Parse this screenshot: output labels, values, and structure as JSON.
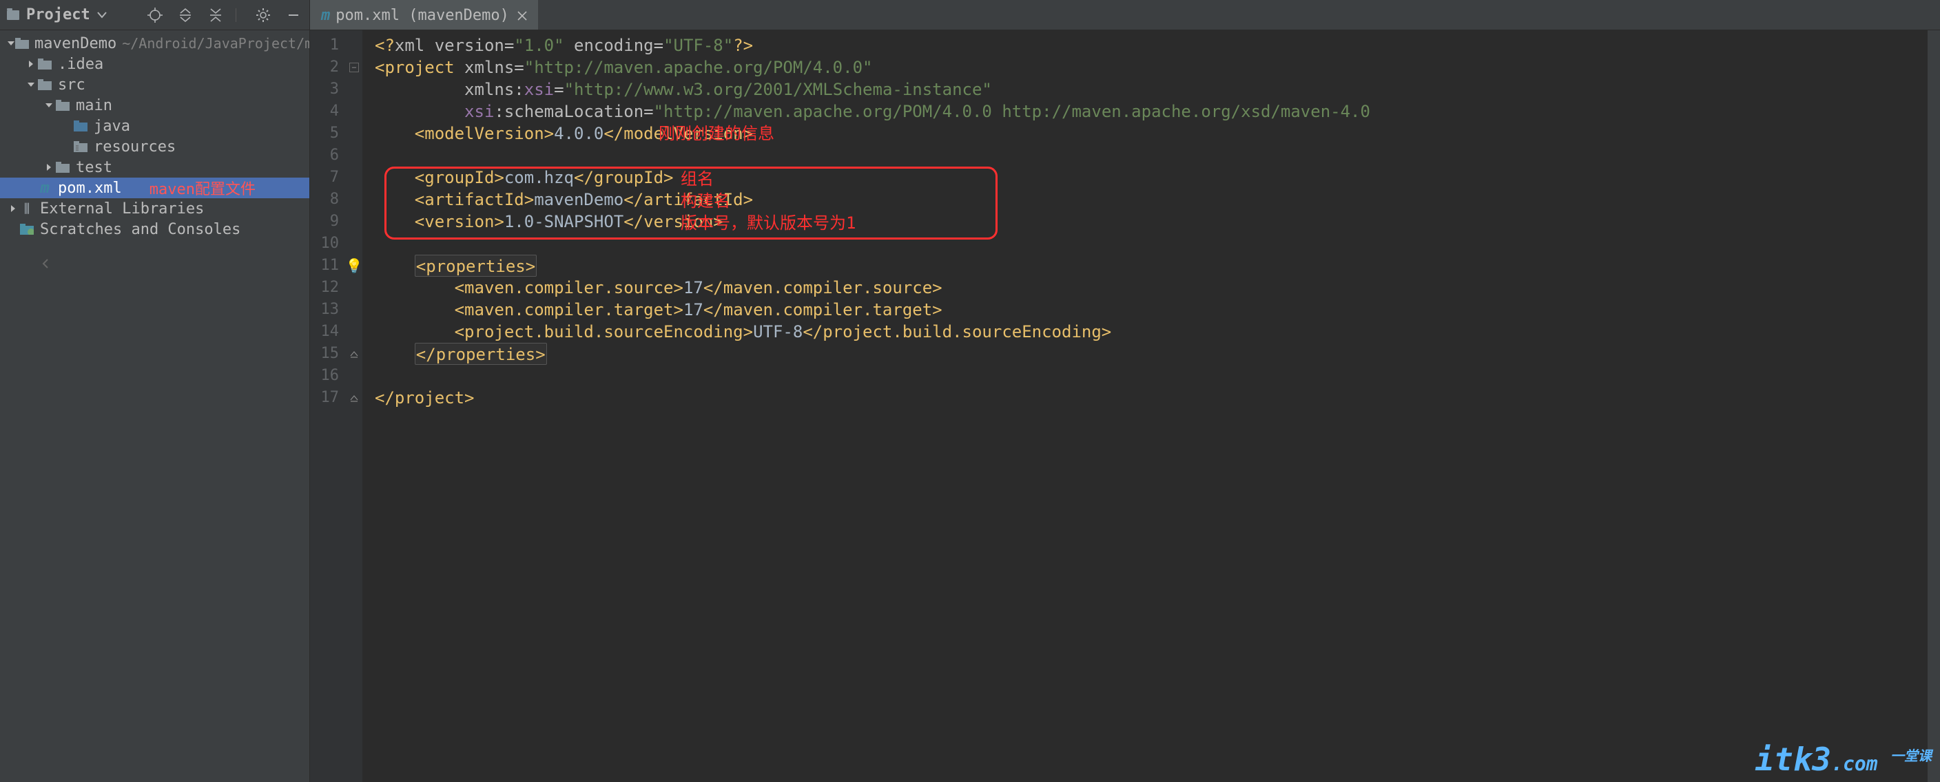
{
  "sidebar": {
    "title": "Project",
    "items": [
      {
        "label": "mavenDemo",
        "sub": "~/Android/JavaProject/mavenDem",
        "depth": 0,
        "expanded": true,
        "icon": "folder-project",
        "arrow": "down"
      },
      {
        "label": ".idea",
        "depth": 1,
        "icon": "folder",
        "arrow": "right"
      },
      {
        "label": "src",
        "depth": 1,
        "icon": "folder",
        "arrow": "down"
      },
      {
        "label": "main",
        "depth": 2,
        "icon": "folder",
        "arrow": "down"
      },
      {
        "label": "java",
        "depth": 3,
        "icon": "folder-blue",
        "arrow": ""
      },
      {
        "label": "resources",
        "depth": 3,
        "icon": "folder-res",
        "arrow": ""
      },
      {
        "label": "test",
        "depth": 2,
        "icon": "folder",
        "arrow": "right"
      },
      {
        "label": "pom.xml",
        "depth": 1,
        "icon": "m",
        "arrow": "",
        "selected": true,
        "annot": "maven配置文件"
      },
      {
        "label": "External Libraries",
        "depth": 0,
        "icon": "lib",
        "arrow": "right"
      },
      {
        "label": "Scratches and Consoles",
        "depth": 0,
        "icon": "scratch",
        "arrow": ""
      }
    ]
  },
  "tab": {
    "title": "pom.xml (mavenDemo)"
  },
  "annotations": {
    "header": "刚刚创建的信息",
    "group": "组名",
    "artifact": "构建名",
    "version": "版本号，默认版本号为1"
  },
  "code": {
    "lines": [
      {
        "n": 1,
        "fold": "",
        "segs": [
          {
            "t": "<?",
            "c": "c-tag"
          },
          {
            "t": "xml version",
            "c": "c-attr"
          },
          {
            "t": "=",
            "c": "c-attr"
          },
          {
            "t": "\"1.0\"",
            "c": "c-str"
          },
          {
            "t": " encoding",
            "c": "c-attr"
          },
          {
            "t": "=",
            "c": "c-attr"
          },
          {
            "t": "\"UTF-8\"",
            "c": "c-str"
          },
          {
            "t": "?>",
            "c": "c-tag"
          }
        ]
      },
      {
        "n": 2,
        "fold": "minus",
        "segs": [
          {
            "t": "<project ",
            "c": "c-tag"
          },
          {
            "t": "xmlns",
            "c": "c-attr"
          },
          {
            "t": "=",
            "c": "c-attr"
          },
          {
            "t": "\"http://maven.apache.org/POM/4.0.0\"",
            "c": "c-str"
          }
        ]
      },
      {
        "n": 3,
        "segs": [
          {
            "t": "         ",
            "c": "c-text"
          },
          {
            "t": "xmlns:",
            "c": "c-attr"
          },
          {
            "t": "xsi",
            "c": "c-ns"
          },
          {
            "t": "=",
            "c": "c-attr"
          },
          {
            "t": "\"http://www.w3.org/2001/XMLSchema-instance\"",
            "c": "c-str"
          }
        ]
      },
      {
        "n": 4,
        "segs": [
          {
            "t": "         ",
            "c": "c-text"
          },
          {
            "t": "xsi",
            "c": "c-ns"
          },
          {
            "t": ":schemaLocation",
            "c": "c-attr"
          },
          {
            "t": "=",
            "c": "c-attr"
          },
          {
            "t": "\"http://maven.apache.org/POM/4.0.0 http://maven.apache.org/xsd/maven-4.0",
            "c": "c-str"
          }
        ]
      },
      {
        "n": 5,
        "segs": [
          {
            "t": "    ",
            "c": "c-text"
          },
          {
            "t": "<modelVersion>",
            "c": "c-tag"
          },
          {
            "t": "4.0.0",
            "c": "c-text"
          },
          {
            "t": "</modelVersion>",
            "c": "c-tag"
          }
        ]
      },
      {
        "n": 6,
        "segs": []
      },
      {
        "n": 7,
        "segs": [
          {
            "t": "    ",
            "c": "c-text"
          },
          {
            "t": "<groupId>",
            "c": "c-tag"
          },
          {
            "t": "com.hzq",
            "c": "c-text"
          },
          {
            "t": "</groupId>",
            "c": "c-tag"
          }
        ]
      },
      {
        "n": 8,
        "segs": [
          {
            "t": "    ",
            "c": "c-text"
          },
          {
            "t": "<artifactId>",
            "c": "c-tag"
          },
          {
            "t": "mavenDemo",
            "c": "c-text"
          },
          {
            "t": "</artifactId>",
            "c": "c-tag"
          }
        ]
      },
      {
        "n": 9,
        "segs": [
          {
            "t": "    ",
            "c": "c-text"
          },
          {
            "t": "<version>",
            "c": "c-tag"
          },
          {
            "t": "1.0-SNAPSHOT",
            "c": "c-text"
          },
          {
            "t": "</version>",
            "c": "c-tag"
          }
        ]
      },
      {
        "n": 10,
        "segs": []
      },
      {
        "n": 11,
        "fold": "bulb",
        "hl": true,
        "segs": [
          {
            "t": "    ",
            "c": "c-text"
          },
          {
            "t": "<properties>",
            "c": "c-tag c-hl"
          }
        ]
      },
      {
        "n": 12,
        "segs": [
          {
            "t": "        ",
            "c": "c-text"
          },
          {
            "t": "<maven.compiler.source>",
            "c": "c-tag"
          },
          {
            "t": "17",
            "c": "c-text"
          },
          {
            "t": "</maven.compiler.source>",
            "c": "c-tag"
          }
        ]
      },
      {
        "n": 13,
        "segs": [
          {
            "t": "        ",
            "c": "c-text"
          },
          {
            "t": "<maven.compiler.target>",
            "c": "c-tag"
          },
          {
            "t": "17",
            "c": "c-text"
          },
          {
            "t": "</maven.compiler.target>",
            "c": "c-tag"
          }
        ]
      },
      {
        "n": 14,
        "segs": [
          {
            "t": "        ",
            "c": "c-text"
          },
          {
            "t": "<project.build.sourceEncoding>",
            "c": "c-tag"
          },
          {
            "t": "UTF-8",
            "c": "c-text"
          },
          {
            "t": "</project.build.sourceEncoding>",
            "c": "c-tag"
          }
        ]
      },
      {
        "n": 15,
        "fold": "up",
        "segs": [
          {
            "t": "    ",
            "c": "c-text"
          },
          {
            "t": "</properties>",
            "c": "c-tag c-hl"
          }
        ]
      },
      {
        "n": 16,
        "segs": []
      },
      {
        "n": 17,
        "fold": "up",
        "segs": [
          {
            "t": "</project>",
            "c": "c-tag"
          }
        ]
      }
    ]
  },
  "watermark": {
    "main": "itk3",
    "sub": "一堂课",
    "suffix": ".com"
  }
}
